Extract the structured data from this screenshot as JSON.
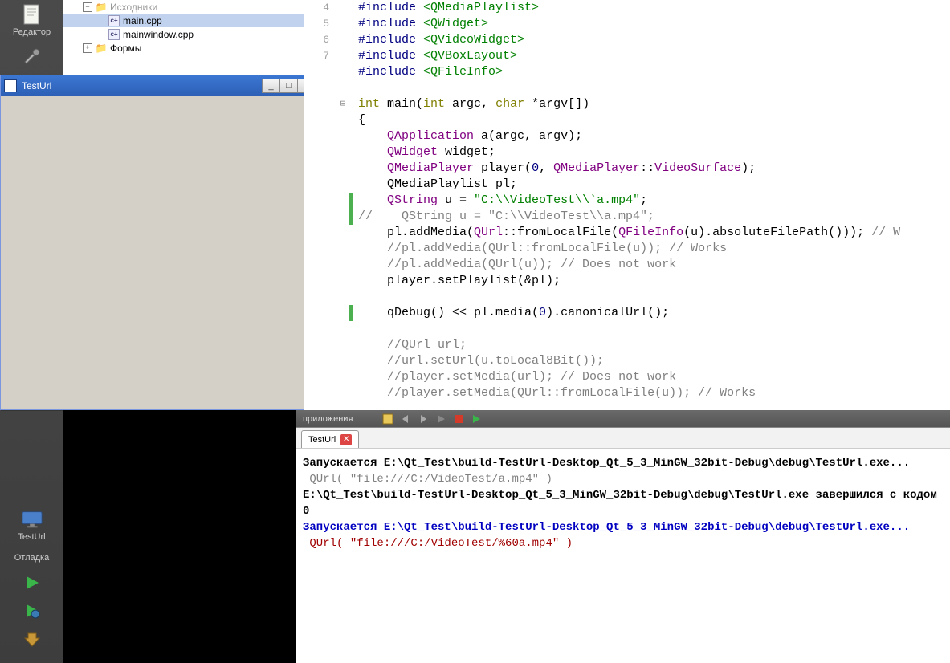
{
  "sidebar": {
    "editor_label": "Редактор",
    "project_label": "TestUrl",
    "debug_label": "Отладка"
  },
  "tree": {
    "header_label": "Исходники",
    "file1": "main.cpp",
    "file2": "mainwindow.cpp",
    "forms_label": "Формы"
  },
  "app_window": {
    "title": "TestUrl"
  },
  "editor": {
    "lines": [
      {
        "n": "4",
        "fold": "",
        "mark": false,
        "html": "<span class='pp'>#include</span> <span class='pph'>&lt;QMediaPlaylist&gt;</span>"
      },
      {
        "n": "5",
        "fold": "",
        "mark": false,
        "html": "<span class='pp'>#include</span> <span class='pph'>&lt;QWidget&gt;</span>"
      },
      {
        "n": "6",
        "fold": "",
        "mark": false,
        "html": "<span class='pp'>#include</span> <span class='pph'>&lt;QVideoWidget&gt;</span>"
      },
      {
        "n": "7",
        "fold": "",
        "mark": false,
        "html": "<span class='pp'>#include</span> <span class='pph'>&lt;QVBoxLayout&gt;</span>"
      },
      {
        "n": "",
        "fold": "",
        "mark": false,
        "html": "<span class='pp'>#include</span> <span class='pph'>&lt;QFileInfo&gt;</span>"
      },
      {
        "n": "",
        "fold": "",
        "mark": false,
        "html": ""
      },
      {
        "n": "",
        "fold": "⊟",
        "mark": false,
        "html": "<span class='kw'>int</span> main(<span class='kw'>int</span> argc, <span class='kw'>char</span> *argv[])"
      },
      {
        "n": "",
        "fold": "",
        "mark": false,
        "html": "{"
      },
      {
        "n": "",
        "fold": "",
        "mark": false,
        "html": "    <span class='type'>QApplication</span> a(argc, argv);"
      },
      {
        "n": "",
        "fold": "",
        "mark": false,
        "html": "    <span class='type'>QWidget</span> widget;"
      },
      {
        "n": "",
        "fold": "",
        "mark": false,
        "html": "    <span class='type'>QMediaPlayer</span> player(<span class='num'>0</span>, <span class='type'>QMediaPlayer</span>::<span class='type'>VideoSurface</span>);"
      },
      {
        "n": "",
        "fold": "",
        "mark": false,
        "html": "    QMediaPlaylist pl;"
      },
      {
        "n": "",
        "fold": "",
        "mark": true,
        "html": "    <span class='type'>QString</span> u = <span class='str'>\"C:\\\\VideoTest\\\\`a.mp4\"</span>;"
      },
      {
        "n": "",
        "fold": "",
        "mark": true,
        "html": "<span class='com'>//    QString u = \"C:\\\\VideoTest\\\\a.mp4\";</span>"
      },
      {
        "n": "",
        "fold": "",
        "mark": false,
        "html": "    pl.addMedia(<span class='type'>QUrl</span>::fromLocalFile(<span class='type'>QFileInfo</span>(u).absoluteFilePath())); <span class='com'>// W</span>"
      },
      {
        "n": "",
        "fold": "",
        "mark": false,
        "html": "    <span class='com'>//pl.addMedia(QUrl::fromLocalFile(u)); // Works</span>"
      },
      {
        "n": "",
        "fold": "",
        "mark": false,
        "html": "    <span class='com'>//pl.addMedia(QUrl(u)); // Does not work</span>"
      },
      {
        "n": "",
        "fold": "",
        "mark": false,
        "html": "    player.setPlaylist(&amp;pl);"
      },
      {
        "n": "",
        "fold": "",
        "mark": false,
        "html": ""
      },
      {
        "n": "",
        "fold": "",
        "mark": true,
        "html": "    qDebug() &lt;&lt; pl.media(<span class='num'>0</span>).canonicalUrl();"
      },
      {
        "n": "",
        "fold": "",
        "mark": false,
        "html": ""
      },
      {
        "n": "",
        "fold": "",
        "mark": false,
        "html": "    <span class='com'>//QUrl url;</span>"
      },
      {
        "n": "",
        "fold": "",
        "mark": false,
        "html": "    <span class='com'>//url.setUrl(u.toLocal8Bit());</span>"
      },
      {
        "n": "",
        "fold": "",
        "mark": false,
        "html": "    <span class='com'>//player.setMedia(url); // Does not work</span>"
      },
      {
        "n": "",
        "fold": "",
        "mark": false,
        "html": "    <span class='com'>//player.setMedia(QUrl::fromLocalFile(u)); // Works</span>"
      }
    ]
  },
  "output": {
    "toolbar_label": "приложения",
    "tab_label": "TestUrl",
    "lines": [
      {
        "cls": "bold",
        "text": "Запускается E:\\Qt_Test\\build-TestUrl-Desktop_Qt_5_3_MinGW_32bit-Debug\\debug\\TestUrl.exe..."
      },
      {
        "cls": "gray",
        "text": " QUrl( \"file:///C:/VideoTest/a.mp4\" ) "
      },
      {
        "cls": "bold",
        "text": "E:\\Qt_Test\\build-TestUrl-Desktop_Qt_5_3_MinGW_32bit-Debug\\debug\\TestUrl.exe завершился с кодом 0"
      },
      {
        "cls": "",
        "text": ""
      },
      {
        "cls": "bold blue",
        "text": "Запускается E:\\Qt_Test\\build-TestUrl-Desktop_Qt_5_3_MinGW_32bit-Debug\\debug\\TestUrl.exe..."
      },
      {
        "cls": "maroon",
        "text": " QUrl( \"file:///C:/VideoTest/%60a.mp4\" ) "
      }
    ]
  }
}
